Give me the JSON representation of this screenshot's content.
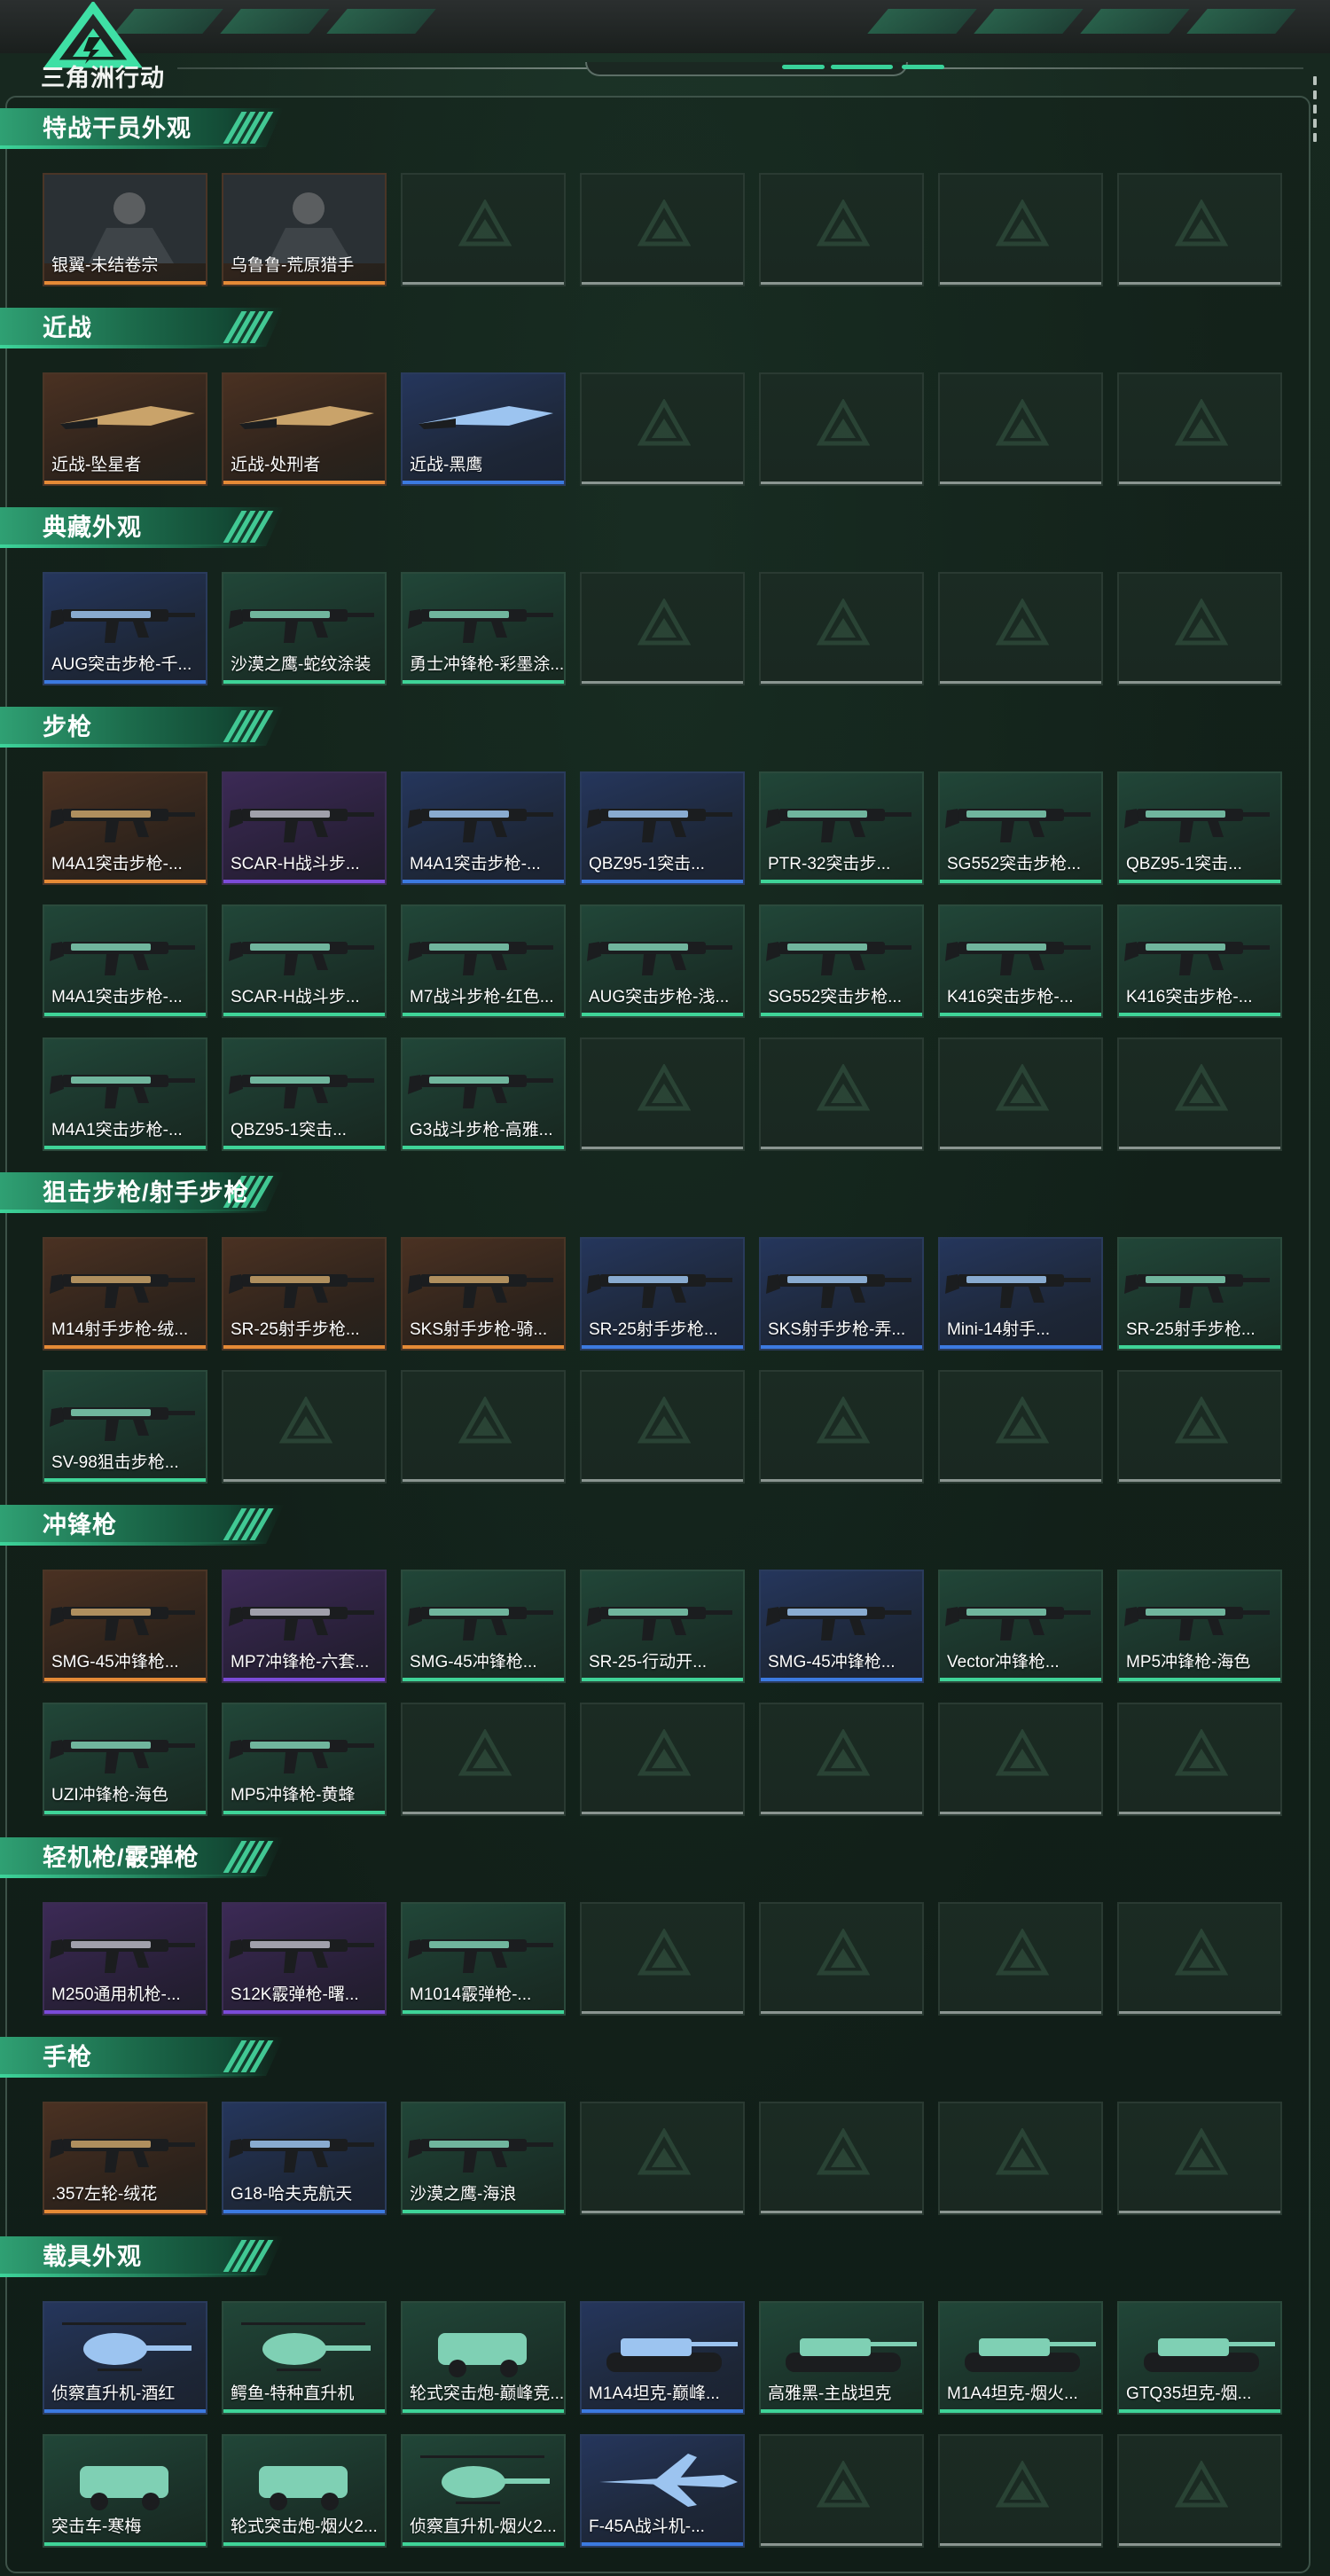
{
  "header": {
    "logo_text": "三角洲行动"
  },
  "sections": [
    {
      "title": "特战干员外观",
      "items": [
        {
          "label": "银翼-未结卷宗",
          "rarity": "orange",
          "icon": "operator-portrait"
        },
        {
          "label": "乌鲁鲁-荒原猎手",
          "rarity": "orange",
          "icon": "operator-portrait"
        }
      ]
    },
    {
      "title": "近战",
      "items": [
        {
          "label": "近战-坠星者",
          "rarity": "orange",
          "icon": "blade-weapon"
        },
        {
          "label": "近战-处刑者",
          "rarity": "orange",
          "icon": "blade-weapon"
        },
        {
          "label": "近战-黑鹰",
          "rarity": "blue",
          "icon": "knife-weapon"
        }
      ]
    },
    {
      "title": "典藏外观",
      "items": [
        {
          "label": "AUG突击步枪-千...",
          "rarity": "blue",
          "icon": "rifle-weapon"
        },
        {
          "label": "沙漠之鹰-蛇纹涂装",
          "rarity": "green",
          "icon": "pistol-weapon"
        },
        {
          "label": "勇士冲锋枪-彩墨涂...",
          "rarity": "green",
          "icon": "smg-weapon"
        }
      ]
    },
    {
      "title": "步枪",
      "items": [
        {
          "label": "M4A1突击步枪-...",
          "rarity": "orange",
          "icon": "rifle-weapon"
        },
        {
          "label": "SCAR-H战斗步...",
          "rarity": "purple",
          "icon": "rifle-weapon"
        },
        {
          "label": "M4A1突击步枪-...",
          "rarity": "blue",
          "icon": "rifle-weapon"
        },
        {
          "label": "QBZ95-1突击...",
          "rarity": "blue",
          "icon": "rifle-weapon"
        },
        {
          "label": "PTR-32突击步...",
          "rarity": "green",
          "icon": "rifle-weapon"
        },
        {
          "label": "SG552突击步枪...",
          "rarity": "green",
          "icon": "rifle-weapon"
        },
        {
          "label": "QBZ95-1突击...",
          "rarity": "green",
          "icon": "rifle-weapon"
        },
        {
          "label": "M4A1突击步枪-...",
          "rarity": "green",
          "icon": "rifle-weapon"
        },
        {
          "label": "SCAR-H战斗步...",
          "rarity": "green",
          "icon": "rifle-weapon"
        },
        {
          "label": "M7战斗步枪-红色...",
          "rarity": "green",
          "icon": "rifle-weapon"
        },
        {
          "label": "AUG突击步枪-浅...",
          "rarity": "green",
          "icon": "rifle-weapon"
        },
        {
          "label": "SG552突击步枪...",
          "rarity": "green",
          "icon": "rifle-weapon"
        },
        {
          "label": "K416突击步枪-...",
          "rarity": "green",
          "icon": "rifle-weapon"
        },
        {
          "label": "K416突击步枪-...",
          "rarity": "green",
          "icon": "rifle-weapon"
        },
        {
          "label": "M4A1突击步枪-...",
          "rarity": "green",
          "icon": "rifle-weapon"
        },
        {
          "label": "QBZ95-1突击...",
          "rarity": "green",
          "icon": "rifle-weapon"
        },
        {
          "label": "G3战斗步枪-高雅...",
          "rarity": "green",
          "icon": "rifle-weapon"
        }
      ]
    },
    {
      "title": "狙击步枪/射手步枪",
      "items": [
        {
          "label": "M14射手步枪-绒...",
          "rarity": "orange",
          "icon": "sniper-weapon"
        },
        {
          "label": "SR-25射手步枪...",
          "rarity": "orange",
          "icon": "sniper-weapon"
        },
        {
          "label": "SKS射手步枪-骑...",
          "rarity": "orange",
          "icon": "sniper-weapon"
        },
        {
          "label": "SR-25射手步枪...",
          "rarity": "blue",
          "icon": "sniper-weapon"
        },
        {
          "label": "SKS射手步枪-弄...",
          "rarity": "blue",
          "icon": "sniper-weapon"
        },
        {
          "label": "Mini-14射手...",
          "rarity": "blue",
          "icon": "sniper-weapon"
        },
        {
          "label": "SR-25射手步枪...",
          "rarity": "green",
          "icon": "sniper-weapon"
        },
        {
          "label": "SV-98狙击步枪...",
          "rarity": "green",
          "icon": "sniper-weapon"
        }
      ]
    },
    {
      "title": "冲锋枪",
      "items": [
        {
          "label": "SMG-45冲锋枪...",
          "rarity": "orange",
          "icon": "smg-weapon"
        },
        {
          "label": "MP7冲锋枪-六套...",
          "rarity": "purple",
          "icon": "smg-weapon"
        },
        {
          "label": "SMG-45冲锋枪...",
          "rarity": "green",
          "icon": "smg-weapon"
        },
        {
          "label": "SR-25-行动开...",
          "rarity": "green",
          "icon": "smg-weapon"
        },
        {
          "label": "SMG-45冲锋枪...",
          "rarity": "blue",
          "icon": "smg-weapon"
        },
        {
          "label": "Vector冲锋枪...",
          "rarity": "green",
          "icon": "smg-weapon"
        },
        {
          "label": "MP5冲锋枪-海色",
          "rarity": "green",
          "icon": "smg-weapon"
        },
        {
          "label": "UZI冲锋枪-海色",
          "rarity": "green",
          "icon": "smg-weapon"
        },
        {
          "label": "MP5冲锋枪-黄蜂",
          "rarity": "green",
          "icon": "smg-weapon"
        }
      ]
    },
    {
      "title": "轻机枪/霰弹枪",
      "items": [
        {
          "label": "M250通用机枪-...",
          "rarity": "purple",
          "icon": "lmg-weapon"
        },
        {
          "label": "S12K霰弹枪-曙...",
          "rarity": "purple",
          "icon": "shotgun-weapon"
        },
        {
          "label": "M1014霰弹枪-...",
          "rarity": "green",
          "icon": "shotgun-weapon"
        }
      ]
    },
    {
      "title": "手枪",
      "items": [
        {
          "label": ".357左轮-绒花",
          "rarity": "orange",
          "icon": "revolver-weapon"
        },
        {
          "label": "G18-哈夫克航天",
          "rarity": "blue",
          "icon": "pistol-weapon"
        },
        {
          "label": "沙漠之鹰-海浪",
          "rarity": "green",
          "icon": "pistol-weapon"
        }
      ]
    },
    {
      "title": "载具外观",
      "items": [
        {
          "label": "侦察直升机-酒红",
          "rarity": "blue",
          "icon": "helicopter-vehicle"
        },
        {
          "label": "鳄鱼-特种直升机",
          "rarity": "green",
          "icon": "helicopter-vehicle"
        },
        {
          "label": "轮式突击炮-巅峰竞...",
          "rarity": "green",
          "icon": "armored-car-vehicle"
        },
        {
          "label": "M1A4坦克-巅峰...",
          "rarity": "blue",
          "icon": "tank-vehicle"
        },
        {
          "label": "高雅黑-主战坦克",
          "rarity": "green",
          "icon": "tank-vehicle"
        },
        {
          "label": "M1A4坦克-烟火...",
          "rarity": "green",
          "icon": "tank-vehicle"
        },
        {
          "label": "GTQ35坦克-烟...",
          "rarity": "green",
          "icon": "tank-vehicle"
        },
        {
          "label": "突击车-寒梅",
          "rarity": "green",
          "icon": "armored-car-vehicle"
        },
        {
          "label": "轮式突击炮-烟火2...",
          "rarity": "green",
          "icon": "armored-car-vehicle"
        },
        {
          "label": "侦察直升机-烟火2...",
          "rarity": "green",
          "icon": "helicopter-vehicle"
        },
        {
          "label": "F-45A战斗机-...",
          "rarity": "blue",
          "icon": "jet-vehicle"
        }
      ]
    }
  ],
  "colors": {
    "orange": "#e58a36",
    "purple": "#7b4bd8",
    "blue": "#3c7ae0",
    "green": "#3fd498",
    "empty": "#8a9590",
    "accent": "#39d29a"
  }
}
